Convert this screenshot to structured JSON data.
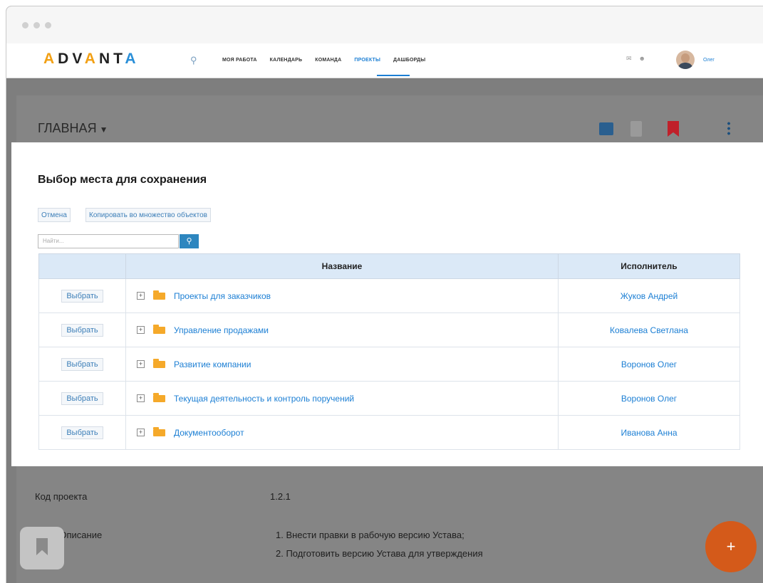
{
  "app": {
    "logo": {
      "p1": "A",
      "p2": "DV",
      "p3": "A",
      "p4": "NT",
      "p5": "A"
    },
    "search_icon": "search-icon",
    "menu": [
      {
        "label": "МОЯ РАБОТА",
        "active": false
      },
      {
        "label": "КАЛЕНДАРЬ",
        "active": false
      },
      {
        "label": "КОМАНДА",
        "active": false
      },
      {
        "label": "ПРОЕКТЫ",
        "active": true
      },
      {
        "label": "ДАШБОРДЫ",
        "active": false
      }
    ],
    "user": {
      "name": "Олег"
    }
  },
  "page": {
    "title": "ГЛАВНАЯ",
    "fields": {
      "project_code_label": "Код проекта",
      "project_code_value": "1.2.1",
      "goal_label": "Цель\\Описание",
      "goal_line1": "1. Внести правки в рабочую версию Устава;",
      "goal_line2": "2. Подготовить версию Устава для утверждения"
    }
  },
  "modal": {
    "title": "Выбор места для сохранения",
    "cancel_label": "Отмена",
    "copy_label": "Копировать во множество объектов",
    "search_placeholder": "Найти...",
    "table": {
      "headers": {
        "name": "Название",
        "owner": "Исполнитель"
      },
      "select_label": "Выбрать",
      "rows": [
        {
          "name": "Проекты для заказчиков",
          "owner": "Жуков Андрей"
        },
        {
          "name": "Управление продажами",
          "owner": "Ковалева Светлана"
        },
        {
          "name": "Развитие компании",
          "owner": "Воронов Олег"
        },
        {
          "name": "Текущая деятельность и контроль поручений",
          "owner": "Воронов Олег"
        },
        {
          "name": "Документооборот",
          "owner": "Иванова Анна"
        }
      ]
    }
  },
  "fab": {
    "label": "+"
  },
  "colors": {
    "accent": "#1c7fd4",
    "danger": "#c0202a",
    "fab": "#d45a1a",
    "logo_orange": "#f2a014"
  }
}
